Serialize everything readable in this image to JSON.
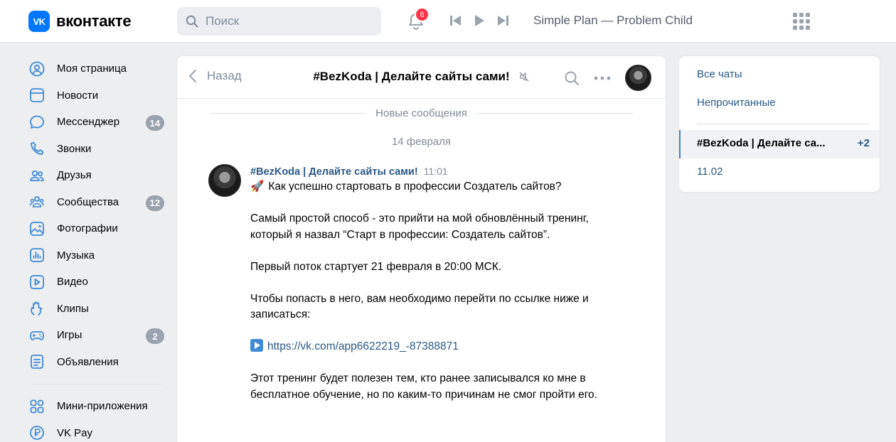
{
  "header": {
    "logo_mark": "VK",
    "logo_text": "вконтакте",
    "search_placeholder": "Поиск",
    "notifications_count": "6",
    "now_playing": "Simple Plan — Problem Child"
  },
  "sidebar": {
    "items": [
      {
        "label": "Моя страница",
        "icon": "user-circle-icon"
      },
      {
        "label": "Новости",
        "icon": "newsfeed-icon"
      },
      {
        "label": "Мессенджер",
        "icon": "message-icon",
        "badge": "14"
      },
      {
        "label": "Звонки",
        "icon": "phone-icon"
      },
      {
        "label": "Друзья",
        "icon": "friends-icon"
      },
      {
        "label": "Сообщества",
        "icon": "communities-icon",
        "badge": "12"
      },
      {
        "label": "Фотографии",
        "icon": "photo-icon"
      },
      {
        "label": "Музыка",
        "icon": "music-icon"
      },
      {
        "label": "Видео",
        "icon": "video-icon"
      },
      {
        "label": "Клипы",
        "icon": "clips-icon"
      },
      {
        "label": "Игры",
        "icon": "games-icon",
        "badge": "2"
      },
      {
        "label": "Объявления",
        "icon": "ads-icon"
      }
    ],
    "extra_items": [
      {
        "label": "Мини-приложения",
        "icon": "mini-apps-icon"
      },
      {
        "label": "VK Pay",
        "icon": "vkpay-icon"
      }
    ]
  },
  "chat": {
    "back_label": "Назад",
    "title": "#BezKoda | Делайте сайты сами!",
    "new_messages_label": "Новые сообщения",
    "date_label": "14 февраля",
    "message": {
      "author": "#BezKoda | Делайте сайты сами!",
      "time": "11:01",
      "line1": "Как успешно стартовать в профессии Создатель сайтов?",
      "para2": "Самый простой способ - это прийти на мой обновлённый тренинг, который я назвал “Старт в профессии: Создатель сайтов”.",
      "para3": "Первый поток стартует 21 февраля в 20:00 МСК.",
      "para4": "Чтобы попасть в него, вам необходимо перейти по ссылке ниже и записаться:",
      "link": "https://vk.com/app6622219_-87388871",
      "para5": "Этот тренинг будет полезен тем, кто ранее записывался ко мне в бесплатное обучение, но по каким-то причинам не смог пройти его."
    }
  },
  "right_panel": {
    "all_chats": "Все чаты",
    "unread": "Непрочитанные",
    "active_chat": "#BezKoda | Делайте са...",
    "active_count": "+2",
    "sub_item": "11.02"
  },
  "colors": {
    "accent": "#0077ff",
    "link": "#2a5885",
    "badge_red": "#ff3347",
    "badge_gray": "#99a2ad",
    "icon_blue": "#3f8ad6"
  }
}
